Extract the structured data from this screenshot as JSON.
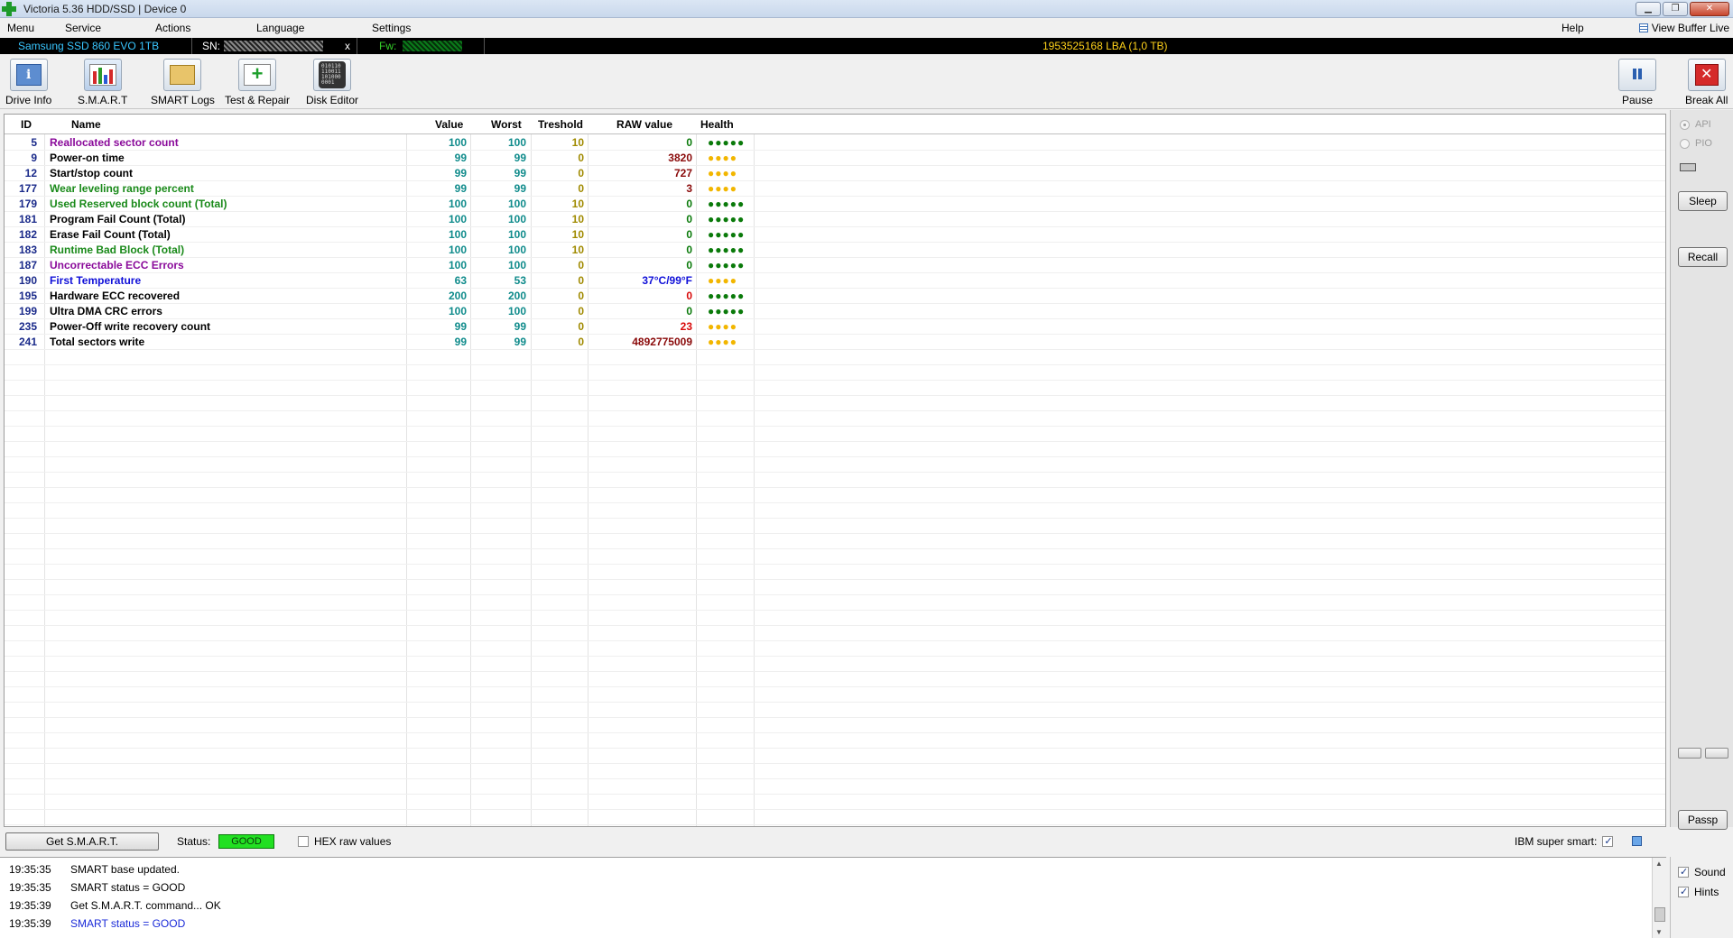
{
  "window": {
    "title": "Victoria 5.36 HDD/SSD | Device 0",
    "controls": [
      "▁",
      "❐",
      "✕"
    ]
  },
  "menu": {
    "items": [
      "Menu",
      "Service",
      "Actions",
      "Language",
      "Settings"
    ],
    "help": "Help",
    "view_buffer": "View Buffer Live"
  },
  "device": {
    "model": "Samsung SSD 860 EVO 1TB",
    "sn_label": "SN:",
    "close_x": "x",
    "fw_label": "Fw:",
    "lba": "1953525168 LBA (1,0 TB)"
  },
  "toolbar": {
    "drive_info": "Drive Info",
    "smart": "S.M.A.R.T",
    "smart_logs": "SMART Logs",
    "test_repair": "Test & Repair",
    "disk_editor": "Disk Editor",
    "pause": "Pause",
    "break_all": "Break All"
  },
  "grid": {
    "headers": {
      "id": "ID",
      "name": "Name",
      "value": "Value",
      "worst": "Worst",
      "threshold": "Treshold",
      "raw": "RAW value",
      "health": "Health"
    },
    "rows": [
      {
        "id": "5",
        "name": "Reallocated sector count",
        "value": "100",
        "worst": "100",
        "threshold": "10",
        "raw": "0",
        "health": "●●●●●"
      },
      {
        "id": "9",
        "name": "Power-on time",
        "value": "99",
        "worst": "99",
        "threshold": "0",
        "raw": "3820",
        "health": "●●●●"
      },
      {
        "id": "12",
        "name": "Start/stop count",
        "value": "99",
        "worst": "99",
        "threshold": "0",
        "raw": "727",
        "health": "●●●●"
      },
      {
        "id": "177",
        "name": "Wear leveling range percent",
        "value": "99",
        "worst": "99",
        "threshold": "0",
        "raw": "3",
        "health": "●●●●"
      },
      {
        "id": "179",
        "name": "Used Reserved block count (Total)",
        "value": "100",
        "worst": "100",
        "threshold": "10",
        "raw": "0",
        "health": "●●●●●"
      },
      {
        "id": "181",
        "name": "Program Fail Count (Total)",
        "value": "100",
        "worst": "100",
        "threshold": "10",
        "raw": "0",
        "health": "●●●●●"
      },
      {
        "id": "182",
        "name": "Erase Fail Count (Total)",
        "value": "100",
        "worst": "100",
        "threshold": "10",
        "raw": "0",
        "health": "●●●●●"
      },
      {
        "id": "183",
        "name": "Runtime Bad Block (Total)",
        "value": "100",
        "worst": "100",
        "threshold": "10",
        "raw": "0",
        "health": "●●●●●"
      },
      {
        "id": "187",
        "name": "Uncorrectable ECC Errors",
        "value": "100",
        "worst": "100",
        "threshold": "0",
        "raw": "0",
        "health": "●●●●●"
      },
      {
        "id": "190",
        "name": "First Temperature",
        "value": "63",
        "worst": "53",
        "threshold": "0",
        "raw": "37°C/99°F",
        "health": "●●●●"
      },
      {
        "id": "195",
        "name": "Hardware ECC recovered",
        "value": "200",
        "worst": "200",
        "threshold": "0",
        "raw": "0",
        "health": "●●●●●"
      },
      {
        "id": "199",
        "name": "Ultra DMA CRC errors",
        "value": "100",
        "worst": "100",
        "threshold": "0",
        "raw": "0",
        "health": "●●●●●"
      },
      {
        "id": "235",
        "name": "Power-Off write recovery count",
        "value": "99",
        "worst": "99",
        "threshold": "0",
        "raw": "23",
        "health": "●●●●"
      },
      {
        "id": "241",
        "name": "Total sectors write",
        "value": "99",
        "worst": "99",
        "threshold": "0",
        "raw": "4892775009",
        "health": "●●●●"
      }
    ]
  },
  "side": {
    "api": "API",
    "pio": "PIO",
    "sleep": "Sleep",
    "recall": "Recall",
    "passp": "Passp"
  },
  "bottom": {
    "get_smart": "Get S.M.A.R.T.",
    "status_label": "Status:",
    "status_value": "GOOD",
    "hex_raw": "HEX raw values",
    "ibm_super_smart": "IBM super smart:"
  },
  "log": [
    {
      "time": "19:35:35",
      "message": "SMART base updated.",
      "color": "#000000"
    },
    {
      "time": "19:35:35",
      "message": "SMART status = GOOD",
      "color": "#000000"
    },
    {
      "time": "19:35:39",
      "message": "Get S.M.A.R.T. command... OK",
      "color": "#000000"
    },
    {
      "time": "19:35:39",
      "message": "SMART status = GOOD",
      "color": "#1a2ad8"
    }
  ],
  "options": {
    "sound": "Sound",
    "hints": "Hints"
  },
  "colors": {
    "name_purple": "#8a0a9a",
    "name_black": "#000000",
    "name_green": "#1a8a1a",
    "name_blue": "#1010d8",
    "raw_green": "#0a7a0a",
    "raw_darkred": "#8a0a0a",
    "raw_red": "#d80a0a",
    "raw_blue": "#1010d8",
    "health_green": "#0a7a0a",
    "health_yellow": "#f2b600"
  }
}
